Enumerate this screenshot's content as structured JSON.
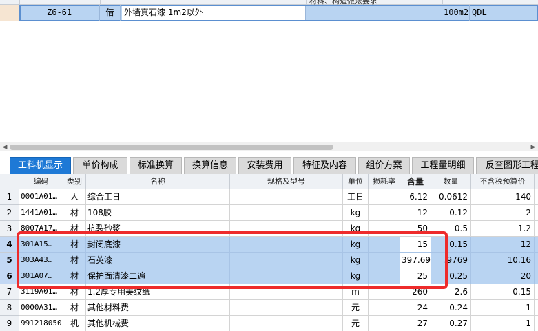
{
  "top_grid": {
    "header_partial_text": "材料、构造做法要求",
    "row": {
      "code": "Z6-61",
      "type": "借",
      "name": "外墙真石漆 1m2以外",
      "unit": "100m2",
      "qty_expr": "QDL"
    }
  },
  "tabs": [
    {
      "label": "工料机显示",
      "active": true
    },
    {
      "label": "单价构成"
    },
    {
      "label": "标准换算"
    },
    {
      "label": "换算信息"
    },
    {
      "label": "安装费用"
    },
    {
      "label": "特征及内容"
    },
    {
      "label": "组价方案"
    },
    {
      "label": "工程量明细"
    },
    {
      "label": "反查图形工程量"
    }
  ],
  "table": {
    "columns": {
      "code": "编码",
      "category": "类别",
      "name": "名称",
      "spec": "规格及型号",
      "unit": "单位",
      "loss_rate": "损耗率",
      "content": "含量",
      "quantity": "数量",
      "price": "不含税预算价"
    },
    "rows": [
      {
        "no": "1",
        "code": "0001A01…",
        "category": "人",
        "name": "综合工日",
        "spec": "",
        "unit": "工日",
        "loss_rate": "",
        "content": "6.12",
        "quantity": "0.0612",
        "price": "140"
      },
      {
        "no": "2",
        "code": "1441A01…",
        "category": "材",
        "name": "108胶",
        "spec": "",
        "unit": "kg",
        "loss_rate": "",
        "content": "12",
        "quantity": "0.12",
        "price": "2"
      },
      {
        "no": "3",
        "code": "8007A17…",
        "category": "材",
        "name": "抗裂砂浆",
        "spec": "",
        "unit": "kg",
        "loss_rate": "",
        "content": "50",
        "quantity": "0.5",
        "price": "1.2"
      },
      {
        "no": "4",
        "code": "301A15…",
        "category": "材",
        "name": "封闭底漆",
        "spec": "",
        "unit": "kg",
        "loss_rate": "",
        "content": "15",
        "quantity": "0.15",
        "price": "12"
      },
      {
        "no": "5",
        "code": "303A43…",
        "category": "材",
        "name": "石英漆",
        "spec": "",
        "unit": "kg",
        "loss_rate": "",
        "content": "397.69",
        "quantity": ".9769",
        "price": "10.16"
      },
      {
        "no": "6",
        "code": "301A07…",
        "category": "材",
        "name": "保护面清漆二遍",
        "spec": "",
        "unit": "kg",
        "loss_rate": "",
        "content": "25",
        "quantity": "0.25",
        "price": "20"
      },
      {
        "no": "7",
        "code": "3119A01…",
        "category": "材",
        "name": "1.2厚专用美纹纸",
        "spec": "",
        "unit": "m",
        "loss_rate": "",
        "content": "260",
        "quantity": "2.6",
        "price": "0.15"
      },
      {
        "no": "8",
        "code": "0000A31…",
        "category": "材",
        "name": "其他材料费",
        "spec": "",
        "unit": "元",
        "loss_rate": "",
        "content": "24",
        "quantity": "0.24",
        "price": "1"
      },
      {
        "no": "9",
        "code": "991218050",
        "category": "机",
        "name": "其他机械费",
        "spec": "",
        "unit": "元",
        "loss_rate": "",
        "content": "27",
        "quantity": "0.27",
        "price": "1"
      }
    ]
  },
  "colors": {
    "accent": "#1e79d6",
    "selection": "#b9d4f2",
    "highlight_box": "#ee2b2b"
  }
}
